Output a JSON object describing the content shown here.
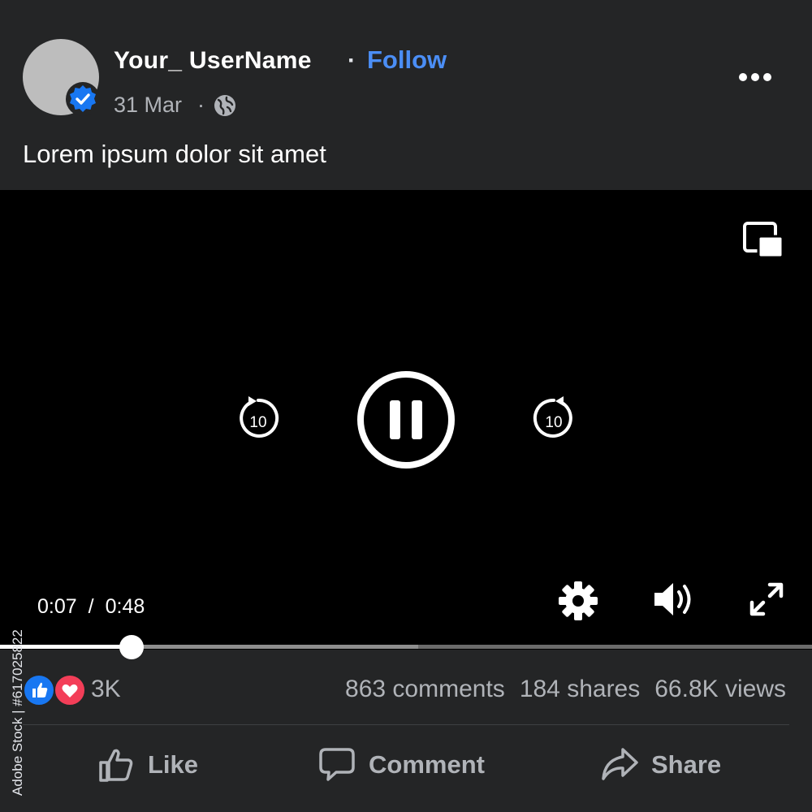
{
  "post": {
    "username": "Your_ UserName",
    "separator": "·",
    "follow_label": "Follow",
    "date": "31 Mar",
    "date_separator": "·",
    "audience_icon": "globe-icon",
    "more_icon": "more-icon",
    "caption": "Lorem ipsum dolor sit amet"
  },
  "video": {
    "current_time": "0:07",
    "time_separator": "/",
    "duration": "0:48",
    "progress_fraction": 0.162,
    "buffered_fraction": 0.515,
    "rewind_seconds": "10",
    "forward_seconds": "10",
    "icons": [
      "picture-in-picture-icon",
      "rewind-10-icon",
      "pause-icon",
      "forward-10-icon",
      "settings-icon",
      "volume-icon",
      "fullscreen-icon"
    ]
  },
  "engagement": {
    "reaction_count": "3K",
    "comments": "863 comments",
    "shares": "184 shares",
    "views": "66.8K views"
  },
  "actions": {
    "like": "Like",
    "comment": "Comment",
    "share": "Share"
  },
  "side_text": "Adobe Stock | #617025822",
  "colors": {
    "background": "#242526",
    "video_background": "#000000",
    "follow": "#4b8ef5",
    "verified": "#1877f2",
    "like_reaction": "#1877f2",
    "love_reaction": "#f33e58",
    "muted_text": "#b0b3b8"
  }
}
